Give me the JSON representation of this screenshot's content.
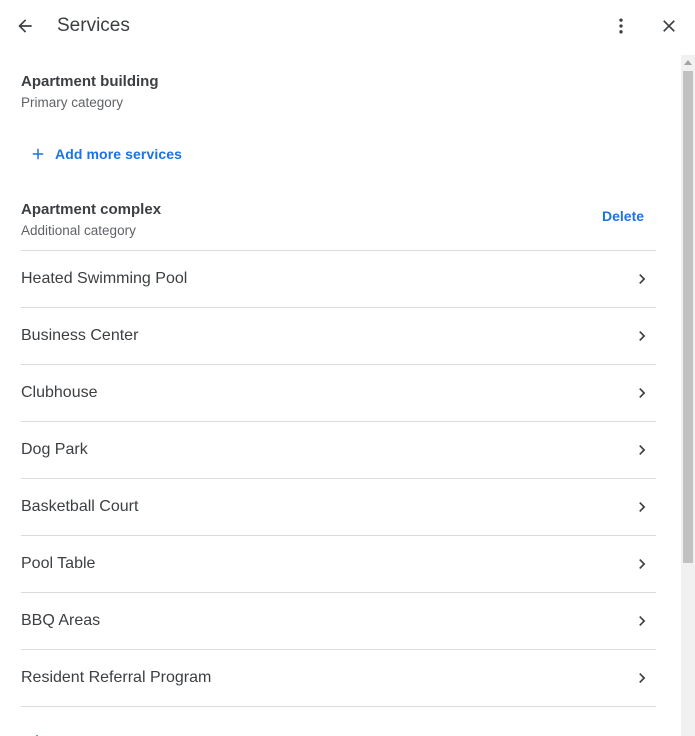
{
  "header": {
    "title": "Services",
    "back_icon": "arrow-left-icon",
    "more_icon": "more-vertical-icon",
    "close_icon": "close-icon"
  },
  "primary_category": {
    "name": "Apartment building",
    "type": "Primary category"
  },
  "add_services": {
    "label": "Add more services",
    "icon": "plus-icon"
  },
  "additional_category": {
    "name": "Apartment complex",
    "type": "Additional category",
    "delete_label": "Delete"
  },
  "services": [
    {
      "label": "Heated Swimming Pool"
    },
    {
      "label": "Business Center"
    },
    {
      "label": "Clubhouse"
    },
    {
      "label": "Dog Park"
    },
    {
      "label": "Basketball Court"
    },
    {
      "label": "Pool Table"
    },
    {
      "label": "BBQ Areas"
    },
    {
      "label": "Resident Referral Program"
    }
  ],
  "colors": {
    "accent": "#1a73e8",
    "text": "#3c4043",
    "secondary_text": "#5f6368",
    "divider": "#dadce0"
  }
}
